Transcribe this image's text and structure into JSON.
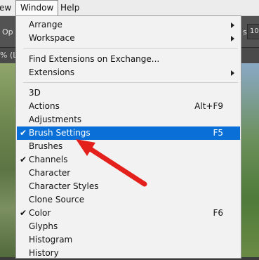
{
  "menubar": {
    "view": "ew",
    "window": "Window",
    "help": "Help"
  },
  "optbar": {
    "op_label": "Op",
    "s_label": "s:",
    "num_value": "10"
  },
  "tab": {
    "percent": "% (L"
  },
  "menu": {
    "items": [
      {
        "label": "Arrange",
        "submenu": true
      },
      {
        "label": "Workspace",
        "submenu": true
      },
      {
        "label": "Find Extensions on Exchange..."
      },
      {
        "label": "Extensions",
        "submenu": true
      },
      {
        "label": "3D"
      },
      {
        "label": "Actions",
        "shortcut": "Alt+F9"
      },
      {
        "label": "Adjustments"
      },
      {
        "label": "Brush Settings",
        "shortcut": "F5",
        "checked": true,
        "selected": true
      },
      {
        "label": "Brushes"
      },
      {
        "label": "Channels",
        "checked": true
      },
      {
        "label": "Character"
      },
      {
        "label": "Character Styles"
      },
      {
        "label": "Clone Source"
      },
      {
        "label": "Color",
        "shortcut": "F6",
        "checked": true
      },
      {
        "label": "Glyphs"
      },
      {
        "label": "Histogram"
      },
      {
        "label": "History"
      }
    ],
    "check_glyph": "✔"
  },
  "colors": {
    "selection": "#0a6fd6",
    "annotation_arrow": "#e3201b"
  }
}
